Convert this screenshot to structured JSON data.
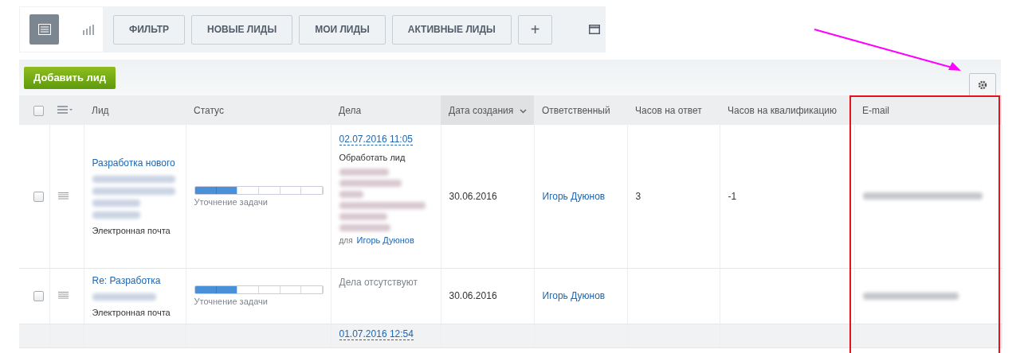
{
  "view_switch": [
    {
      "kind": "list",
      "selected": true
    },
    {
      "kind": "chart",
      "selected": false
    }
  ],
  "filters": [
    {
      "label": "ФИЛЬТР"
    },
    {
      "label": "НОВЫЕ ЛИДЫ"
    },
    {
      "label": "МОИ ЛИДЫ"
    },
    {
      "label": "АКТИВНЫЕ ЛИДЫ"
    },
    {
      "label": "+"
    }
  ],
  "add_button": "Добавить лид",
  "table": {
    "all_checked": false,
    "columns": [
      {
        "label": "Лид",
        "sorted": false
      },
      {
        "label": "Статус",
        "sorted": false
      },
      {
        "label": "Дела",
        "sorted": false
      },
      {
        "label": "Дата создания",
        "sorted": true
      },
      {
        "label": "Ответственный",
        "sorted": false
      },
      {
        "label": "Часов на ответ",
        "sorted": false
      },
      {
        "label": "Часов на квалификацию",
        "sorted": false
      },
      {
        "label": "E-mail",
        "sorted": false
      }
    ],
    "rows": [
      {
        "checked": false,
        "lead_title": "Разработка нового",
        "lead_source": "Электронная почта",
        "status": {
          "level": 0.33,
          "label": "Уточнение задачи"
        },
        "task_date": "02.07.2016 11:05",
        "task_title": "Обработать лид",
        "task_for": "для",
        "task_owner": "Игорь Дуюнов",
        "created": "30.06.2016",
        "responsible": "Игорь Дуюнов",
        "hours_answer": "3",
        "hours_qual": "-1"
      },
      {
        "checked": false,
        "lead_title": "Re: Разработка",
        "lead_source": "Электронная почта",
        "status": {
          "level": 0.33,
          "label": "Уточнение задачи"
        },
        "tasks_empty": "Дела отсутствуют",
        "created": "30.06.2016",
        "responsible": "Игорь Дуюнов"
      },
      {
        "task_date": "01.07.2016 12:54"
      }
    ]
  },
  "highlight": {
    "kind": "box"
  }
}
